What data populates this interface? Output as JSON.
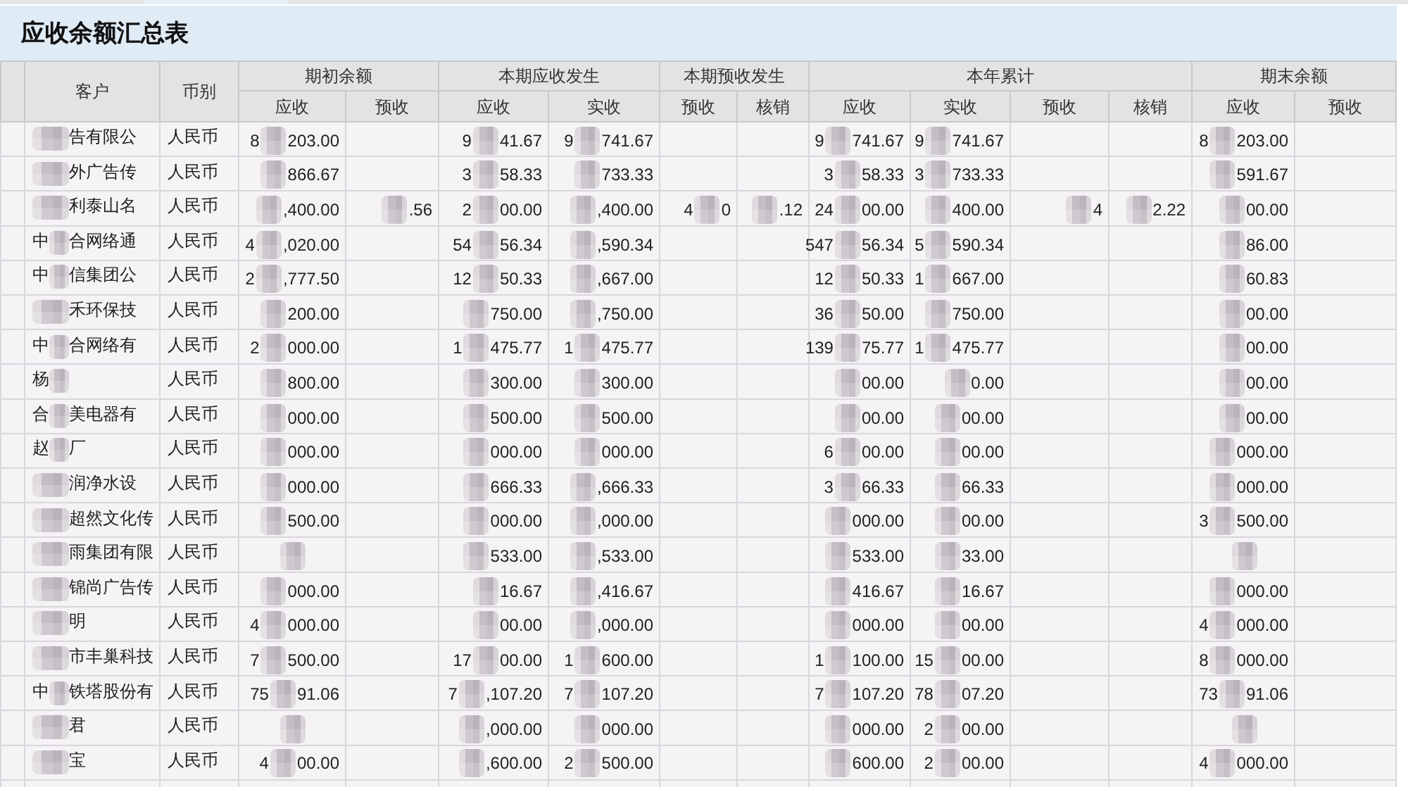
{
  "title_bar": {
    "title": "应收余额汇总表"
  },
  "table": {
    "columns": [
      {
        "label": "客户"
      },
      {
        "label": "币别"
      }
    ],
    "column_groups": [
      {
        "label": "期初余额",
        "columns": [
          "应收",
          "预收"
        ]
      },
      {
        "label": "本期应收发生",
        "columns": [
          "应收",
          "实收"
        ]
      },
      {
        "label": "本期预收发生",
        "columns": [
          "预收",
          "核销"
        ]
      },
      {
        "label": "本年累计",
        "columns": [
          "应收",
          "实收",
          "预收",
          "核销"
        ]
      },
      {
        "label": "期末余额",
        "columns": [
          "应收",
          "预收"
        ]
      }
    ],
    "rows": [
      {
        "customer": {
          "redacted": true,
          "post": "告有限公"
        },
        "currency": "人民币",
        "amounts": {
          "opening_receivable": {
            "redacted": true,
            "pre": "8",
            "post": "203.00"
          },
          "period_receivable": {
            "redacted": true,
            "pre": "9",
            "post": "41.67"
          },
          "period_received": {
            "redacted": true,
            "pre": "9",
            "post": "741.67"
          },
          "ytd_receivable": {
            "redacted": true,
            "pre": "9",
            "post": "741.67"
          },
          "ytd_received": {
            "redacted": true,
            "pre": "9",
            "post": "741.67"
          },
          "closing_receivable": {
            "redacted": true,
            "pre": "8",
            "post": "203.00"
          }
        }
      },
      {
        "customer": {
          "redacted": true,
          "post": "外广告传"
        },
        "currency": "人民币",
        "amounts": {
          "opening_receivable": {
            "redacted": true,
            "post": "866.67"
          },
          "period_receivable": {
            "redacted": true,
            "pre": "3",
            "post": "58.33"
          },
          "period_received": {
            "redacted": true,
            "post": "733.33"
          },
          "ytd_receivable": {
            "redacted": true,
            "pre": "3",
            "post": "58.33"
          },
          "ytd_received": {
            "redacted": true,
            "pre": "3",
            "post": "733.33"
          },
          "closing_receivable": {
            "redacted": true,
            "post": "591.67"
          }
        }
      },
      {
        "customer": {
          "redacted": true,
          "post": "利泰山名"
        },
        "currency": "人民币",
        "amounts": {
          "opening_receivable": {
            "redacted": true,
            "post": ",400.00"
          },
          "opening_advance": {
            "redacted": true,
            "post": ".56"
          },
          "period_receivable": {
            "redacted": true,
            "pre": "2",
            "post": "00.00"
          },
          "period_received": {
            "redacted": true,
            "post": ",400.00"
          },
          "period_advance": {
            "redacted": true,
            "pre": "4",
            "post": "0"
          },
          "period_writeoff": {
            "redacted": true,
            "post": ".12"
          },
          "ytd_receivable": {
            "redacted": true,
            "pre": "24",
            "post": "00.00"
          },
          "ytd_received": {
            "redacted": true,
            "post": "400.00"
          },
          "ytd_advance": {
            "redacted": true,
            "post": "4"
          },
          "ytd_writeoff": {
            "redacted": true,
            "post": "2.22"
          },
          "closing_receivable": {
            "redacted": true,
            "post": "00.00"
          }
        }
      },
      {
        "customer": {
          "redacted": true,
          "pre": "中",
          "post": "合网络通"
        },
        "currency": "人民币",
        "amounts": {
          "opening_receivable": {
            "redacted": true,
            "pre": "4",
            "post": ",020.00"
          },
          "period_receivable": {
            "redacted": true,
            "pre": "54",
            "post": "56.34"
          },
          "period_received": {
            "redacted": true,
            "post": ",590.34"
          },
          "ytd_receivable": {
            "redacted": true,
            "pre": "547",
            "post": "56.34"
          },
          "ytd_received": {
            "redacted": true,
            "pre": "5",
            "post": "590.34"
          },
          "closing_receivable": {
            "redacted": true,
            "post": "86.00"
          }
        }
      },
      {
        "customer": {
          "redacted": true,
          "pre": "中",
          "post": "信集团公"
        },
        "currency": "人民币",
        "amounts": {
          "opening_receivable": {
            "redacted": true,
            "pre": "2",
            "post": ",777.50"
          },
          "period_receivable": {
            "redacted": true,
            "pre": "12",
            "post": "50.33"
          },
          "period_received": {
            "redacted": true,
            "post": ",667.00"
          },
          "ytd_receivable": {
            "redacted": true,
            "pre": "12",
            "post": "50.33"
          },
          "ytd_received": {
            "redacted": true,
            "pre": "1",
            "post": "667.00"
          },
          "closing_receivable": {
            "redacted": true,
            "post": "60.83"
          }
        }
      },
      {
        "customer": {
          "redacted": true,
          "post": "禾环保技"
        },
        "currency": "人民币",
        "amounts": {
          "opening_receivable": {
            "redacted": true,
            "post": "200.00"
          },
          "period_receivable": {
            "redacted": true,
            "post": "750.00"
          },
          "period_received": {
            "redacted": true,
            "post": ",750.00"
          },
          "ytd_receivable": {
            "redacted": true,
            "pre": "36",
            "post": "50.00"
          },
          "ytd_received": {
            "redacted": true,
            "post": "750.00"
          },
          "closing_receivable": {
            "redacted": true,
            "post": "00.00"
          }
        }
      },
      {
        "customer": {
          "redacted": true,
          "pre": "中",
          "post": "合网络有"
        },
        "currency": "人民币",
        "amounts": {
          "opening_receivable": {
            "redacted": true,
            "pre": "2",
            "post": "000.00"
          },
          "period_receivable": {
            "redacted": true,
            "pre": "1",
            "post": "475.77"
          },
          "period_received": {
            "redacted": true,
            "pre": "1",
            "post": "475.77"
          },
          "ytd_receivable": {
            "redacted": true,
            "pre": "139",
            "post": "75.77"
          },
          "ytd_received": {
            "redacted": true,
            "pre": "1",
            "post": "475.77"
          },
          "closing_receivable": {
            "redacted": true,
            "post": "00.00"
          }
        }
      },
      {
        "customer": {
          "redacted": true,
          "pre": "杨"
        },
        "currency": "人民币",
        "amounts": {
          "opening_receivable": {
            "redacted": true,
            "post": "800.00"
          },
          "period_receivable": {
            "redacted": true,
            "post": "300.00"
          },
          "period_received": {
            "redacted": true,
            "post": "300.00"
          },
          "ytd_receivable": {
            "redacted": true,
            "post": "00.00"
          },
          "ytd_received": {
            "redacted": true,
            "post": "0.00"
          },
          "closing_receivable": {
            "redacted": true,
            "post": "00.00"
          }
        }
      },
      {
        "customer": {
          "redacted": true,
          "pre": "合",
          "post": "美电器有"
        },
        "currency": "人民币",
        "amounts": {
          "opening_receivable": {
            "redacted": true,
            "post": "000.00"
          },
          "period_receivable": {
            "redacted": true,
            "post": "500.00"
          },
          "period_received": {
            "redacted": true,
            "post": "500.00"
          },
          "ytd_receivable": {
            "redacted": true,
            "post": "00.00"
          },
          "ytd_received": {
            "redacted": true,
            "post": "00.00"
          },
          "closing_receivable": {
            "redacted": true,
            "post": "00.00"
          }
        }
      },
      {
        "customer": {
          "redacted": true,
          "pre": "赵",
          "post": "厂"
        },
        "currency": "人民币",
        "amounts": {
          "opening_receivable": {
            "redacted": true,
            "post": "000.00"
          },
          "period_receivable": {
            "redacted": true,
            "post": "000.00"
          },
          "period_received": {
            "redacted": true,
            "post": "000.00"
          },
          "ytd_receivable": {
            "redacted": true,
            "pre": "6",
            "post": "00.00"
          },
          "ytd_received": {
            "redacted": true,
            "post": "00.00"
          },
          "closing_receivable": {
            "redacted": true,
            "post": "000.00"
          }
        }
      },
      {
        "customer": {
          "redacted": true,
          "post": "润净水设"
        },
        "currency": "人民币",
        "amounts": {
          "opening_receivable": {
            "redacted": true,
            "post": "000.00"
          },
          "period_receivable": {
            "redacted": true,
            "post": "666.33"
          },
          "period_received": {
            "redacted": true,
            "post": ",666.33"
          },
          "ytd_receivable": {
            "redacted": true,
            "pre": "3",
            "post": "66.33"
          },
          "ytd_received": {
            "redacted": true,
            "post": "66.33"
          },
          "closing_receivable": {
            "redacted": true,
            "post": "000.00"
          }
        }
      },
      {
        "customer": {
          "redacted": true,
          "post": "超然文化传"
        },
        "currency": "人民币",
        "amounts": {
          "opening_receivable": {
            "redacted": true,
            "post": "500.00"
          },
          "period_receivable": {
            "redacted": true,
            "post": "000.00"
          },
          "period_received": {
            "redacted": true,
            "post": ",000.00"
          },
          "ytd_receivable": {
            "redacted": true,
            "post": "000.00"
          },
          "ytd_received": {
            "redacted": true,
            "post": "00.00"
          },
          "closing_receivable": {
            "redacted": true,
            "pre": "3",
            "post": "500.00"
          }
        }
      },
      {
        "customer": {
          "redacted": true,
          "post": "雨集团有限"
        },
        "currency": "人民币",
        "amounts": {
          "opening_receivable": {
            "redacted": true
          },
          "period_receivable": {
            "redacted": true,
            "post": "533.00"
          },
          "period_received": {
            "redacted": true,
            "post": ",533.00"
          },
          "ytd_receivable": {
            "redacted": true,
            "post": "533.00"
          },
          "ytd_received": {
            "redacted": true,
            "post": "33.00"
          },
          "closing_receivable": {
            "redacted": true
          }
        }
      },
      {
        "customer": {
          "redacted": true,
          "post": "锦尚广告传"
        },
        "currency": "人民币",
        "amounts": {
          "opening_receivable": {
            "redacted": true,
            "post": "000.00"
          },
          "period_receivable": {
            "redacted": true,
            "post": "16.67"
          },
          "period_received": {
            "redacted": true,
            "post": ",416.67"
          },
          "ytd_receivable": {
            "redacted": true,
            "post": "416.67"
          },
          "ytd_received": {
            "redacted": true,
            "post": "16.67"
          },
          "closing_receivable": {
            "redacted": true,
            "post": "000.00"
          }
        }
      },
      {
        "customer": {
          "redacted": true,
          "post": "明"
        },
        "currency": "人民币",
        "amounts": {
          "opening_receivable": {
            "redacted": true,
            "pre": "4",
            "post": "000.00"
          },
          "period_receivable": {
            "redacted": true,
            "post": "00.00"
          },
          "period_received": {
            "redacted": true,
            "post": ",000.00"
          },
          "ytd_receivable": {
            "redacted": true,
            "post": "000.00"
          },
          "ytd_received": {
            "redacted": true,
            "post": "00.00"
          },
          "closing_receivable": {
            "redacted": true,
            "pre": "4",
            "post": "000.00"
          }
        }
      },
      {
        "customer": {
          "redacted": true,
          "post": "市丰巢科技"
        },
        "currency": "人民币",
        "amounts": {
          "opening_receivable": {
            "redacted": true,
            "pre": "7",
            "post": "500.00"
          },
          "period_receivable": {
            "redacted": true,
            "pre": "17",
            "post": "00.00"
          },
          "period_received": {
            "redacted": true,
            "pre": "1",
            "post": "600.00"
          },
          "ytd_receivable": {
            "redacted": true,
            "pre": "1",
            "post": "100.00"
          },
          "ytd_received": {
            "redacted": true,
            "pre": "15",
            "post": "00.00"
          },
          "closing_receivable": {
            "redacted": true,
            "pre": "8",
            "post": "000.00"
          }
        }
      },
      {
        "customer": {
          "redacted": true,
          "pre": "中",
          "post": "铁塔股份有"
        },
        "currency": "人民币",
        "amounts": {
          "opening_receivable": {
            "redacted": true,
            "pre": "75",
            "post": "91.06"
          },
          "period_receivable": {
            "redacted": true,
            "pre": "7",
            "post": ",107.20"
          },
          "period_received": {
            "redacted": true,
            "pre": "7",
            "post": "107.20"
          },
          "ytd_receivable": {
            "redacted": true,
            "pre": "7",
            "post": "107.20"
          },
          "ytd_received": {
            "redacted": true,
            "pre": "78",
            "post": "07.20"
          },
          "closing_receivable": {
            "redacted": true,
            "pre": "73",
            "post": "91.06"
          }
        }
      },
      {
        "customer": {
          "redacted": true,
          "post": "君"
        },
        "currency": "人民币",
        "amounts": {
          "opening_receivable": {
            "redacted": true
          },
          "period_receivable": {
            "redacted": true,
            "post": ",000.00"
          },
          "period_received": {
            "redacted": true,
            "post": "000.00"
          },
          "ytd_receivable": {
            "redacted": true,
            "post": "000.00"
          },
          "ytd_received": {
            "redacted": true,
            "pre": "2",
            "post": "00.00"
          },
          "closing_receivable": {
            "redacted": true
          }
        }
      },
      {
        "customer": {
          "redacted": true,
          "post": "宝"
        },
        "currency": "人民币",
        "amounts": {
          "opening_receivable": {
            "redacted": true,
            "pre": "4",
            "post": "00.00"
          },
          "period_receivable": {
            "redacted": true,
            "post": ",600.00"
          },
          "period_received": {
            "redacted": true,
            "pre": "2",
            "post": "500.00"
          },
          "ytd_receivable": {
            "redacted": true,
            "post": "600.00"
          },
          "ytd_received": {
            "redacted": true,
            "pre": "2",
            "post": "00.00"
          },
          "closing_receivable": {
            "redacted": true,
            "pre": "4",
            "post": "000.00"
          }
        }
      }
    ]
  }
}
